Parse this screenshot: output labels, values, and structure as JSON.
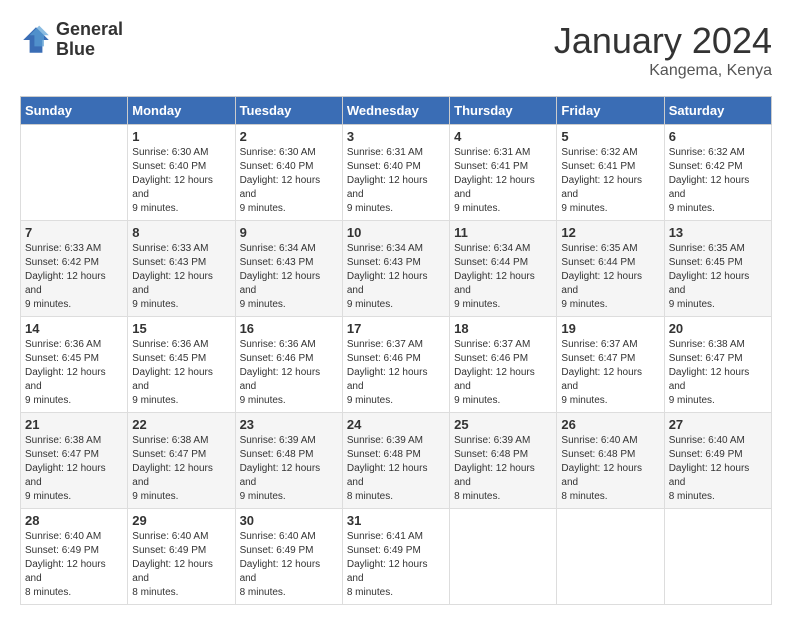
{
  "header": {
    "logo_line1": "General",
    "logo_line2": "Blue",
    "month": "January 2024",
    "location": "Kangema, Kenya"
  },
  "weekdays": [
    "Sunday",
    "Monday",
    "Tuesday",
    "Wednesday",
    "Thursday",
    "Friday",
    "Saturday"
  ],
  "weeks": [
    [
      {
        "day": "",
        "sunrise": "",
        "sunset": "",
        "daylight": ""
      },
      {
        "day": "1",
        "sunrise": "Sunrise: 6:30 AM",
        "sunset": "Sunset: 6:40 PM",
        "daylight": "Daylight: 12 hours and 9 minutes."
      },
      {
        "day": "2",
        "sunrise": "Sunrise: 6:30 AM",
        "sunset": "Sunset: 6:40 PM",
        "daylight": "Daylight: 12 hours and 9 minutes."
      },
      {
        "day": "3",
        "sunrise": "Sunrise: 6:31 AM",
        "sunset": "Sunset: 6:40 PM",
        "daylight": "Daylight: 12 hours and 9 minutes."
      },
      {
        "day": "4",
        "sunrise": "Sunrise: 6:31 AM",
        "sunset": "Sunset: 6:41 PM",
        "daylight": "Daylight: 12 hours and 9 minutes."
      },
      {
        "day": "5",
        "sunrise": "Sunrise: 6:32 AM",
        "sunset": "Sunset: 6:41 PM",
        "daylight": "Daylight: 12 hours and 9 minutes."
      },
      {
        "day": "6",
        "sunrise": "Sunrise: 6:32 AM",
        "sunset": "Sunset: 6:42 PM",
        "daylight": "Daylight: 12 hours and 9 minutes."
      }
    ],
    [
      {
        "day": "7",
        "sunrise": "Sunrise: 6:33 AM",
        "sunset": "Sunset: 6:42 PM",
        "daylight": "Daylight: 12 hours and 9 minutes."
      },
      {
        "day": "8",
        "sunrise": "Sunrise: 6:33 AM",
        "sunset": "Sunset: 6:43 PM",
        "daylight": "Daylight: 12 hours and 9 minutes."
      },
      {
        "day": "9",
        "sunrise": "Sunrise: 6:34 AM",
        "sunset": "Sunset: 6:43 PM",
        "daylight": "Daylight: 12 hours and 9 minutes."
      },
      {
        "day": "10",
        "sunrise": "Sunrise: 6:34 AM",
        "sunset": "Sunset: 6:43 PM",
        "daylight": "Daylight: 12 hours and 9 minutes."
      },
      {
        "day": "11",
        "sunrise": "Sunrise: 6:34 AM",
        "sunset": "Sunset: 6:44 PM",
        "daylight": "Daylight: 12 hours and 9 minutes."
      },
      {
        "day": "12",
        "sunrise": "Sunrise: 6:35 AM",
        "sunset": "Sunset: 6:44 PM",
        "daylight": "Daylight: 12 hours and 9 minutes."
      },
      {
        "day": "13",
        "sunrise": "Sunrise: 6:35 AM",
        "sunset": "Sunset: 6:45 PM",
        "daylight": "Daylight: 12 hours and 9 minutes."
      }
    ],
    [
      {
        "day": "14",
        "sunrise": "Sunrise: 6:36 AM",
        "sunset": "Sunset: 6:45 PM",
        "daylight": "Daylight: 12 hours and 9 minutes."
      },
      {
        "day": "15",
        "sunrise": "Sunrise: 6:36 AM",
        "sunset": "Sunset: 6:45 PM",
        "daylight": "Daylight: 12 hours and 9 minutes."
      },
      {
        "day": "16",
        "sunrise": "Sunrise: 6:36 AM",
        "sunset": "Sunset: 6:46 PM",
        "daylight": "Daylight: 12 hours and 9 minutes."
      },
      {
        "day": "17",
        "sunrise": "Sunrise: 6:37 AM",
        "sunset": "Sunset: 6:46 PM",
        "daylight": "Daylight: 12 hours and 9 minutes."
      },
      {
        "day": "18",
        "sunrise": "Sunrise: 6:37 AM",
        "sunset": "Sunset: 6:46 PM",
        "daylight": "Daylight: 12 hours and 9 minutes."
      },
      {
        "day": "19",
        "sunrise": "Sunrise: 6:37 AM",
        "sunset": "Sunset: 6:47 PM",
        "daylight": "Daylight: 12 hours and 9 minutes."
      },
      {
        "day": "20",
        "sunrise": "Sunrise: 6:38 AM",
        "sunset": "Sunset: 6:47 PM",
        "daylight": "Daylight: 12 hours and 9 minutes."
      }
    ],
    [
      {
        "day": "21",
        "sunrise": "Sunrise: 6:38 AM",
        "sunset": "Sunset: 6:47 PM",
        "daylight": "Daylight: 12 hours and 9 minutes."
      },
      {
        "day": "22",
        "sunrise": "Sunrise: 6:38 AM",
        "sunset": "Sunset: 6:47 PM",
        "daylight": "Daylight: 12 hours and 9 minutes."
      },
      {
        "day": "23",
        "sunrise": "Sunrise: 6:39 AM",
        "sunset": "Sunset: 6:48 PM",
        "daylight": "Daylight: 12 hours and 9 minutes."
      },
      {
        "day": "24",
        "sunrise": "Sunrise: 6:39 AM",
        "sunset": "Sunset: 6:48 PM",
        "daylight": "Daylight: 12 hours and 8 minutes."
      },
      {
        "day": "25",
        "sunrise": "Sunrise: 6:39 AM",
        "sunset": "Sunset: 6:48 PM",
        "daylight": "Daylight: 12 hours and 8 minutes."
      },
      {
        "day": "26",
        "sunrise": "Sunrise: 6:40 AM",
        "sunset": "Sunset: 6:48 PM",
        "daylight": "Daylight: 12 hours and 8 minutes."
      },
      {
        "day": "27",
        "sunrise": "Sunrise: 6:40 AM",
        "sunset": "Sunset: 6:49 PM",
        "daylight": "Daylight: 12 hours and 8 minutes."
      }
    ],
    [
      {
        "day": "28",
        "sunrise": "Sunrise: 6:40 AM",
        "sunset": "Sunset: 6:49 PM",
        "daylight": "Daylight: 12 hours and 8 minutes."
      },
      {
        "day": "29",
        "sunrise": "Sunrise: 6:40 AM",
        "sunset": "Sunset: 6:49 PM",
        "daylight": "Daylight: 12 hours and 8 minutes."
      },
      {
        "day": "30",
        "sunrise": "Sunrise: 6:40 AM",
        "sunset": "Sunset: 6:49 PM",
        "daylight": "Daylight: 12 hours and 8 minutes."
      },
      {
        "day": "31",
        "sunrise": "Sunrise: 6:41 AM",
        "sunset": "Sunset: 6:49 PM",
        "daylight": "Daylight: 12 hours and 8 minutes."
      },
      {
        "day": "",
        "sunrise": "",
        "sunset": "",
        "daylight": ""
      },
      {
        "day": "",
        "sunrise": "",
        "sunset": "",
        "daylight": ""
      },
      {
        "day": "",
        "sunrise": "",
        "sunset": "",
        "daylight": ""
      }
    ]
  ]
}
